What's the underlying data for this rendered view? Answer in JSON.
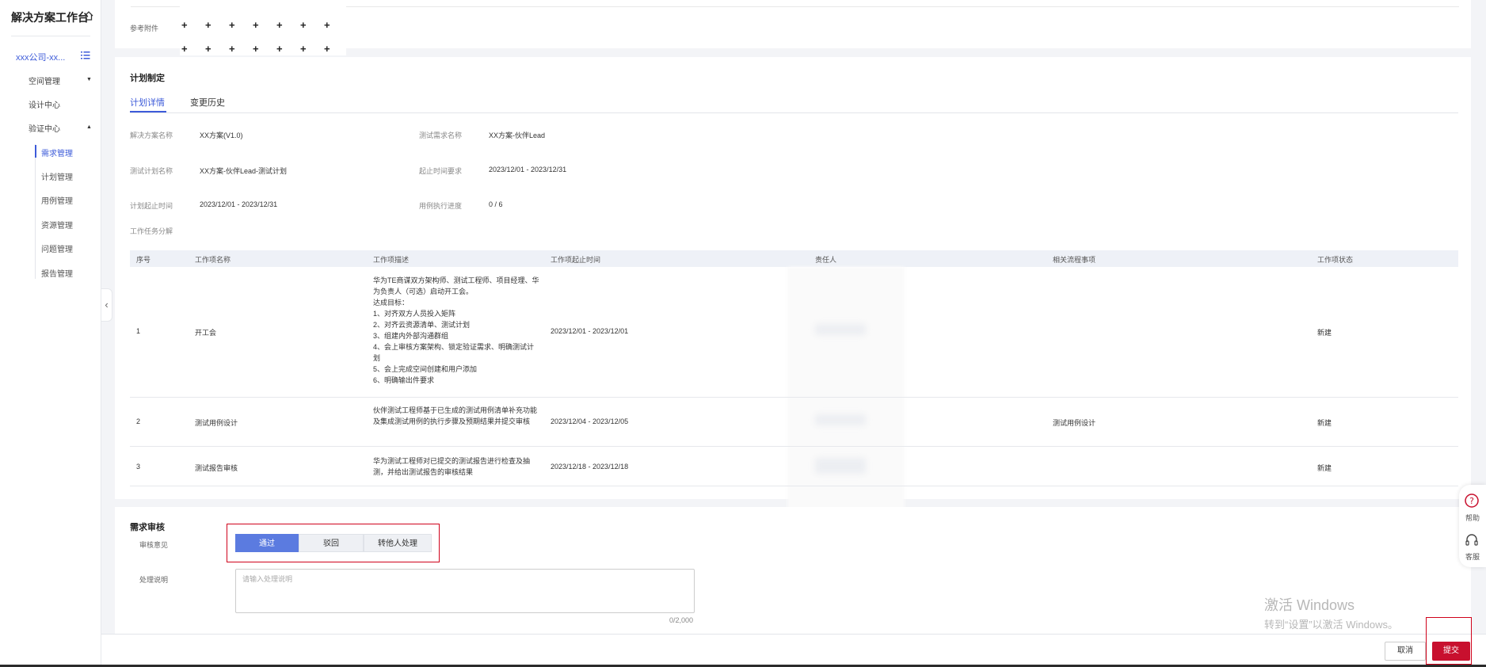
{
  "sidebar": {
    "title": "解决方案工作台",
    "company": "xxx公司-xx...",
    "menu": [
      {
        "label": "空间管理",
        "caret": "▼"
      },
      {
        "label": "设计中心"
      },
      {
        "label": "验证中心",
        "caret": "▲"
      }
    ],
    "submenu": [
      "需求管理",
      "计划管理",
      "用例管理",
      "资源管理",
      "问题管理",
      "报告管理"
    ],
    "active_submenu": "需求管理",
    "collapse_glyph": "‹"
  },
  "attachment": {
    "label": "参考附件",
    "plus": "+"
  },
  "plan": {
    "title": "计划制定",
    "tabs": [
      "计划详情",
      "变更历史"
    ],
    "fields": {
      "solution_name_label": "解决方案名称",
      "solution_name": "XX方案(V1.0)",
      "test_req_label": "测试需求名称",
      "test_req": "XX方案-伙伴Lead",
      "test_plan_label": "测试计划名称",
      "test_plan": "XX方案-伙伴Lead-测试计划",
      "req_period_label": "起止时间要求",
      "req_period": "2023/12/01 - 2023/12/31",
      "plan_period_label": "计划起止时间",
      "plan_period": "2023/12/01 - 2023/12/31",
      "progress_label": "用例执行进度",
      "progress": "0 / 6"
    },
    "breakdown_label": "工作任务分解",
    "table": {
      "headers": [
        "序号",
        "工作项名称",
        "工作项描述",
        "工作项起止时间",
        "责任人",
        "相关流程事项",
        "工作项状态"
      ],
      "rows": [
        {
          "no": "1",
          "name": "开工会",
          "desc": "华为TE商谋双方架构师、测试工程师、项目经理、华为负责人（可选）启动开工会。\n达成目标：\n1、对齐双方人员投入矩阵\n2、对齐云资源清单、测试计划\n3、组建内外部沟通群组\n4、会上审核方案架构、锁定验证需求、明确测试计划\n5、会上完成空间创建和用户添加\n6、明确输出件要求",
          "period": "2023/12/01 - 2023/12/01",
          "related": "",
          "status": "新建"
        },
        {
          "no": "2",
          "name": "测试用例设计",
          "desc": "伙伴测试工程师基于已生成的测试用例清单补充功能及集成测试用例的执行步骤及预期结果并提交审核",
          "period": "2023/12/04 - 2023/12/05",
          "related": "测试用例设计",
          "status": "新建"
        },
        {
          "no": "3",
          "name": "测试报告审核",
          "desc": "华为测试工程师对已提交的测试报告进行检查及抽测，并给出测试报告的审核结果",
          "period": "2023/12/18 - 2023/12/18",
          "related": "",
          "status": "新建"
        }
      ]
    }
  },
  "review": {
    "title": "需求审核",
    "opinion_label": "审核意见",
    "options": [
      "通过",
      "驳回",
      "转他人处理"
    ],
    "selected": "通过",
    "note_label": "处理说明",
    "note_placeholder": "请输入处理说明",
    "counter": "0/2,000"
  },
  "footer": {
    "cancel": "取消",
    "submit": "提交"
  },
  "float": {
    "help": "帮助",
    "service": "客服"
  },
  "watermark": {
    "line1": "激活 Windows",
    "line2": "转到“设置”以激活 Windows。"
  },
  "colors": {
    "accent": "#3d5bd9",
    "submit": "#c8102e",
    "highlight": "#d0021b"
  }
}
